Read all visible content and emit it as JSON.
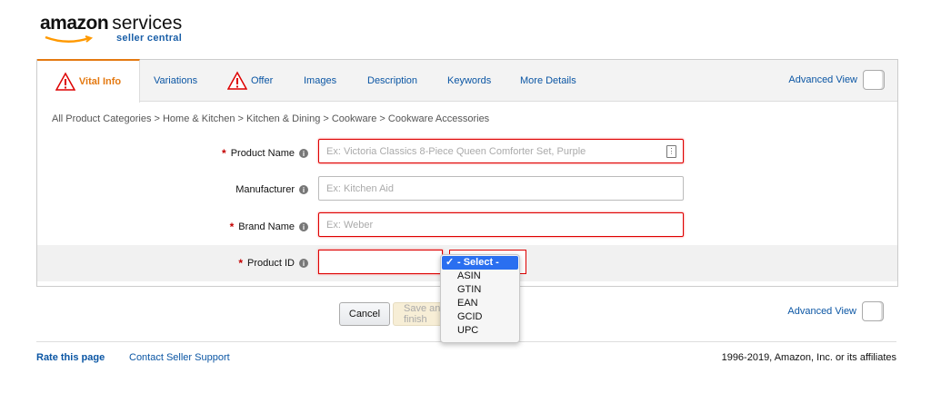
{
  "logo": {
    "brand": "amazon",
    "services": "services",
    "subtitle": "seller central"
  },
  "tabs": [
    {
      "label": "Vital Info",
      "warning": true,
      "active": true
    },
    {
      "label": "Variations"
    },
    {
      "label": "Offer",
      "warning": true
    },
    {
      "label": "Images"
    },
    {
      "label": "Description"
    },
    {
      "label": "Keywords"
    },
    {
      "label": "More Details"
    }
  ],
  "advanced_view_label": "Advanced View",
  "breadcrumb": "All Product Categories > Home & Kitchen > Kitchen & Dining > Cookware > Cookware Accessories",
  "form": {
    "product_name": {
      "label": "Product Name",
      "required": true,
      "placeholder": "Ex: Victoria Classics 8-Piece Queen Comforter Set, Purple"
    },
    "manufacturer": {
      "label": "Manufacturer",
      "required": false,
      "placeholder": "Ex: Kitchen Aid"
    },
    "brand_name": {
      "label": "Brand Name",
      "required": true,
      "placeholder": "Ex: Weber"
    },
    "product_id": {
      "label": "Product ID",
      "required": true,
      "value": ""
    }
  },
  "product_id_type": {
    "selected": "- Select -",
    "options": [
      "- Select -",
      "ASIN",
      "GTIN",
      "EAN",
      "GCID",
      "UPC"
    ]
  },
  "buttons": {
    "cancel": "Cancel",
    "save": "Save and finish"
  },
  "footer": {
    "rate": "Rate this page",
    "contact": "Contact Seller Support",
    "copyright": "1996-2019, Amazon, Inc. or its affiliates"
  },
  "colors": {
    "accent": "#e47911",
    "link": "#0b56a4",
    "error": "#dd0000",
    "selected": "#2a6ff0"
  }
}
